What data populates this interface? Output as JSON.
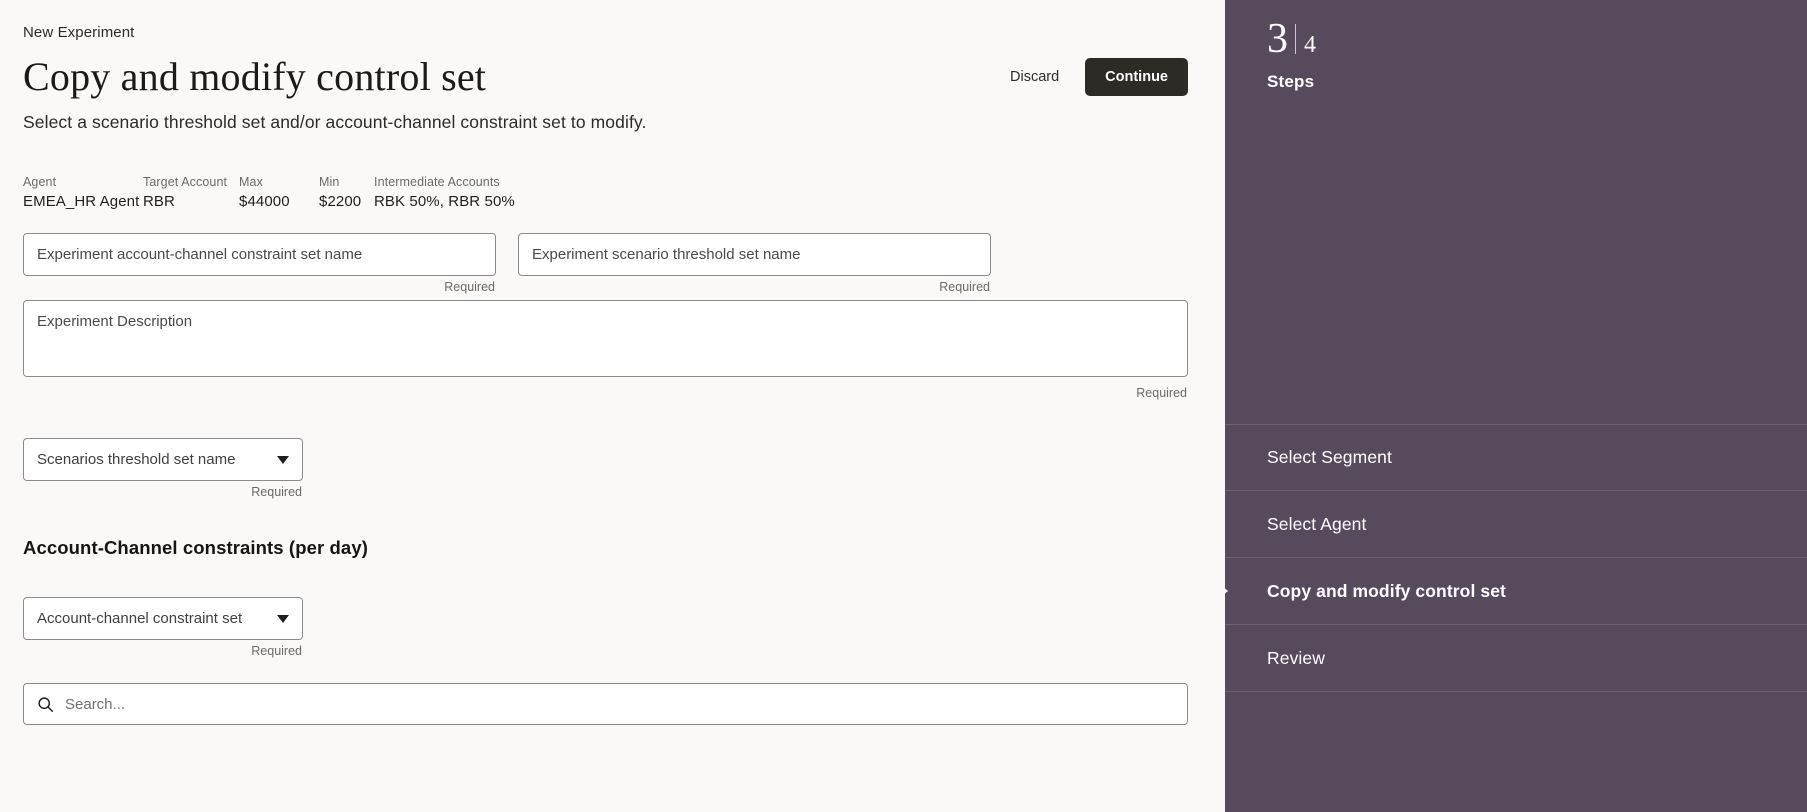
{
  "header": {
    "breadcrumb": "New Experiment",
    "title": "Copy and modify control set",
    "subtitle": "Select a scenario threshold set and/or account-channel constraint set to modify.",
    "discard_label": "Discard",
    "continue_label": "Continue"
  },
  "meta": [
    {
      "label": "Agent",
      "value": "EMEA_HR Agent"
    },
    {
      "label": "Target Account",
      "value": "RBR"
    },
    {
      "label": "Max",
      "value": "$44000"
    },
    {
      "label": "Min",
      "value": "$2200"
    },
    {
      "label": "Intermediate Accounts",
      "value": "RBK 50%, RBR 50%"
    }
  ],
  "form": {
    "constraint_set_name": {
      "placeholder": "Experiment account-channel constraint set name",
      "value": "",
      "helper": "Required"
    },
    "threshold_set_name": {
      "placeholder": "Experiment scenario threshold set name",
      "value": "",
      "helper": "Required"
    },
    "description": {
      "placeholder": "Experiment Description",
      "value": "",
      "helper": "Required"
    },
    "scenarios_select": {
      "value": "Scenarios threshold set name",
      "helper": "Required"
    },
    "section_title": "Account-Channel constraints (per day)",
    "constraint_select": {
      "value": "Account-channel constraint set",
      "helper": "Required"
    },
    "search": {
      "placeholder": "Search...",
      "value": "",
      "icon": "search-icon"
    }
  },
  "sidebar": {
    "current_step": "3",
    "separator": "|",
    "total_steps": "4",
    "steps_label": "Steps",
    "accent_color": "#584a5d",
    "steps": [
      {
        "label": "Select Segment",
        "active": false
      },
      {
        "label": "Select Agent",
        "active": false
      },
      {
        "label": "Copy and modify control set",
        "active": true
      },
      {
        "label": "Review",
        "active": false
      }
    ]
  }
}
